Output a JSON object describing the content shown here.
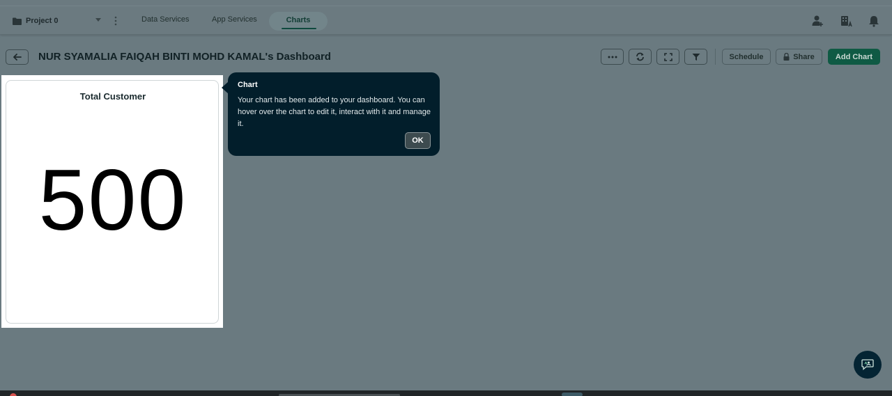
{
  "topbar": {
    "project_name": "Project 0",
    "tabs": [
      {
        "label": "Data Services"
      },
      {
        "label": "App Services"
      },
      {
        "label": "Charts"
      }
    ]
  },
  "dashboard": {
    "title": "NUR SYAMALIA FAIQAH BINTI MOHD KAMAL's Dashboard",
    "buttons": {
      "schedule": "Schedule",
      "share": "Share",
      "add_chart": "Add Chart"
    }
  },
  "chart_card": {
    "title": "Total Customer",
    "value": "500"
  },
  "chart_data": {
    "type": "table",
    "title": "Total Customer",
    "values": [
      500
    ]
  },
  "tooltip": {
    "title": "Chart",
    "body": "Your chart has been added to your dashboard. You can hover over the chart to edit it, interact with it and manage it.",
    "ok_label": "OK"
  },
  "colors": {
    "accent": "#0f5a44",
    "tooltip_bg": "#021e2b",
    "overlay": "#6a7a80"
  }
}
